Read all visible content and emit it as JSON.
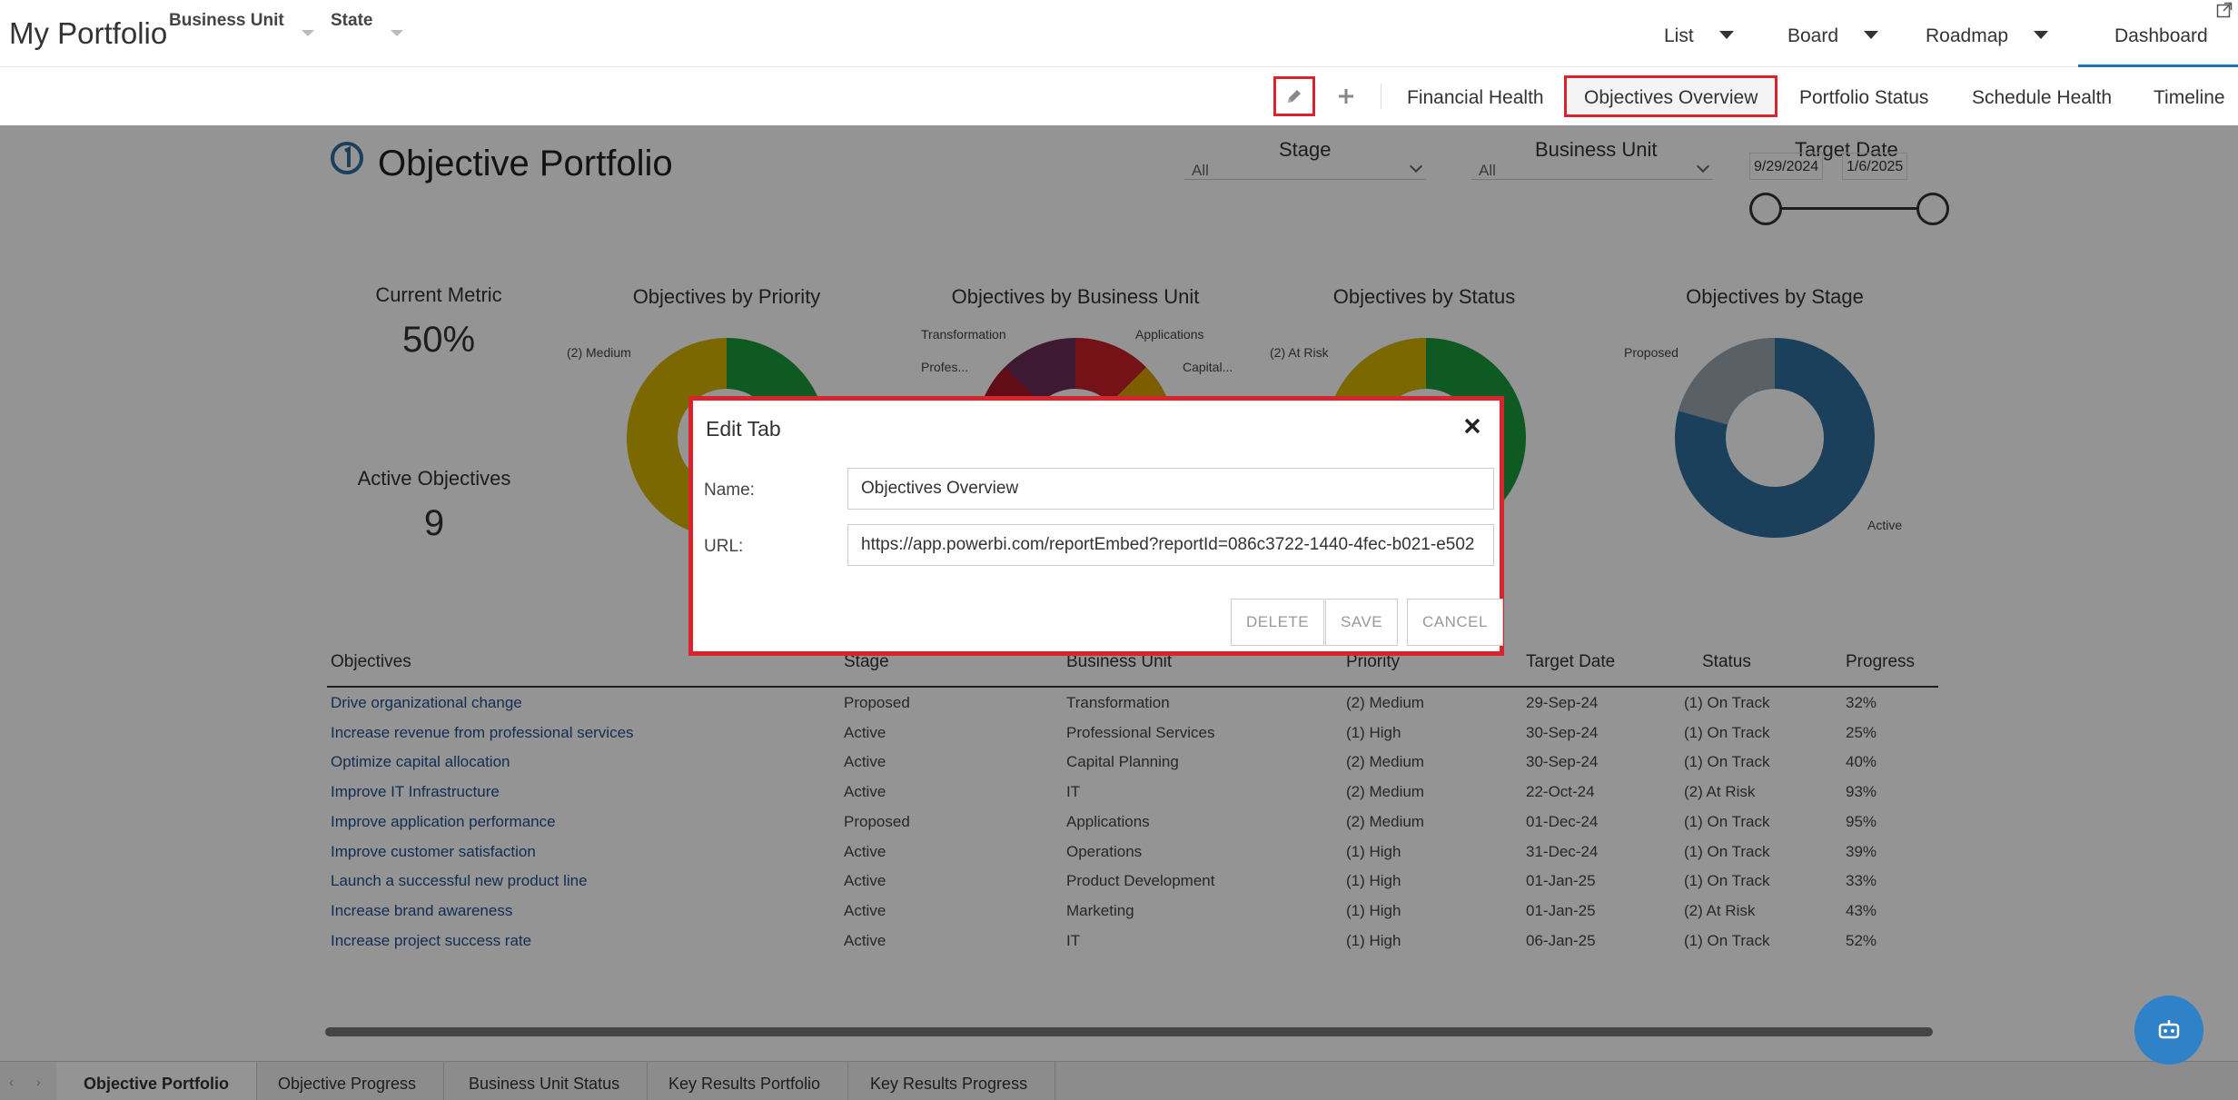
{
  "header": {
    "app_title": "My Portfolio",
    "filters": [
      {
        "label": "Business Unit"
      },
      {
        "label": "State"
      }
    ],
    "views": [
      {
        "label": "List"
      },
      {
        "label": "Board"
      },
      {
        "label": "Roadmap"
      }
    ],
    "dashboard_label": "Dashboard"
  },
  "tabs": {
    "items": [
      {
        "label": "Financial Health"
      },
      {
        "label": "Objectives Overview"
      },
      {
        "label": "Portfolio Status"
      },
      {
        "label": "Schedule Health"
      },
      {
        "label": "Timeline"
      }
    ],
    "active": "Objectives Overview"
  },
  "report": {
    "title": "Objective Portfolio",
    "slicers": {
      "stage": {
        "label": "Stage",
        "value": "All"
      },
      "business_unit": {
        "label": "Business Unit",
        "value": "All"
      },
      "target_date": {
        "label": "Target Date",
        "start": "9/29/2024",
        "end": "1/6/2025"
      }
    },
    "kpis": [
      {
        "label": "Current Metric",
        "value": "50%"
      },
      {
        "label": "Active Objectives",
        "value": "9"
      }
    ],
    "charts": [
      {
        "title": "Objectives by Priority",
        "labels": [
          "(2) Medium"
        ]
      },
      {
        "title": "Objectives by Business Unit",
        "labels": [
          "Transformation",
          "Applications",
          "Profes...",
          "Capital..."
        ]
      },
      {
        "title": "Objectives by Status",
        "labels": [
          "(2) At Risk"
        ]
      },
      {
        "title": "Objectives by Stage",
        "labels": [
          "Proposed",
          "Active"
        ]
      }
    ],
    "table": {
      "columns": [
        "Objectives",
        "Stage",
        "Business Unit",
        "Priority",
        "Target Date",
        "Status",
        "Progress"
      ],
      "rows": [
        [
          "Drive organizational change",
          "Proposed",
          "Transformation",
          "(2) Medium",
          "29-Sep-24",
          "(1) On Track",
          "32%"
        ],
        [
          "Increase revenue from professional services",
          "Active",
          "Professional Services",
          "(1) High",
          "30-Sep-24",
          "(1) On Track",
          "25%"
        ],
        [
          "Optimize capital allocation",
          "Active",
          "Capital Planning",
          "(2) Medium",
          "30-Sep-24",
          "(1) On Track",
          "40%"
        ],
        [
          "Improve IT Infrastructure",
          "Active",
          "IT",
          "(2) Medium",
          "22-Oct-24",
          "(2) At Risk",
          "93%"
        ],
        [
          "Improve application performance",
          "Proposed",
          "Applications",
          "(2) Medium",
          "01-Dec-24",
          "(1) On Track",
          "95%"
        ],
        [
          "Improve customer satisfaction",
          "Active",
          "Operations",
          "(1) High",
          "31-Dec-24",
          "(1) On Track",
          "39%"
        ],
        [
          "Launch a successful new product line",
          "Active",
          "Product Development",
          "(1) High",
          "01-Jan-25",
          "(1) On Track",
          "33%"
        ],
        [
          "Increase brand awareness",
          "Active",
          "Marketing",
          "(1) High",
          "01-Jan-25",
          "(2) At Risk",
          "43%"
        ],
        [
          "Increase project success rate",
          "Active",
          "IT",
          "(1) High",
          "06-Jan-25",
          "(1) On Track",
          "52%"
        ]
      ]
    },
    "page_tabs": [
      {
        "label": "Objective Portfolio"
      },
      {
        "label": "Objective Progress"
      },
      {
        "label": "Business Unit Status"
      },
      {
        "label": "Key Results Portfolio"
      },
      {
        "label": "Key Results Progress"
      }
    ],
    "active_page_tab": "Objective Portfolio"
  },
  "modal": {
    "title": "Edit Tab",
    "name_label": "Name:",
    "name_value": "Objectives Overview",
    "url_label": "URL:",
    "url_value": "https://app.powerbi.com/reportEmbed?reportId=086c3722-1440-4fec-b021-e502",
    "delete_label": "DELETE",
    "save_label": "SAVE",
    "cancel_label": "CANCEL"
  },
  "colors": {
    "highlight": "#d9232d",
    "accent": "#1f6fb3",
    "donut_green": "#1a9c3c",
    "donut_yellow": "#d6b400",
    "donut_red": "#c9202a",
    "donut_blue": "#2e6e9e",
    "donut_gray": "#9aa7b0"
  }
}
